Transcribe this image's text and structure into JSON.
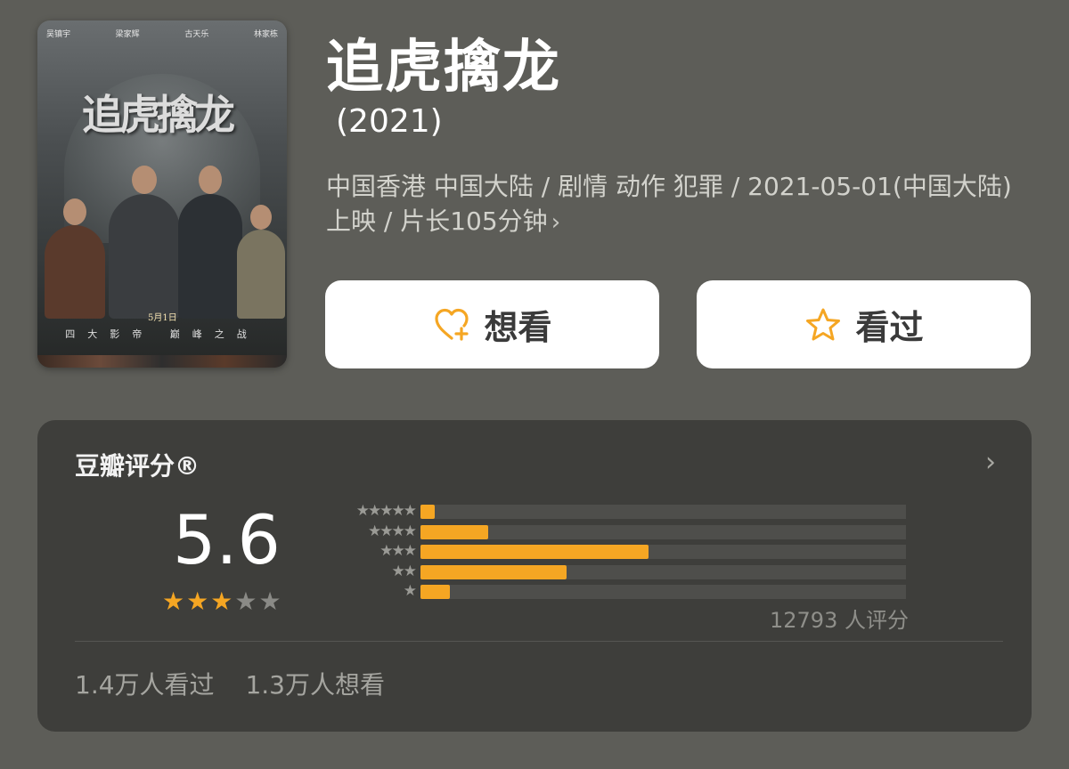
{
  "poster": {
    "title": "追虎擒龙",
    "cast": [
      "吴镇宇",
      "梁家辉",
      "古天乐",
      "林家栋"
    ],
    "tagline": "四大影帝 巅峰之战",
    "date": "5月1日"
  },
  "movie": {
    "title": "追虎擒龙",
    "year": "(2021)",
    "meta": "中国香港 中国大陆 / 剧情 动作 犯罪 / 2021-05-01(中国大陆) 上映 / 片长105分钟"
  },
  "actions": {
    "want_label": "想看",
    "seen_label": "看过",
    "want_icon": "heart-plus-icon",
    "seen_icon": "star-outline-icon",
    "accent": "#f5a623"
  },
  "rating": {
    "title": "豆瓣评分®",
    "score": "5.6",
    "stars_filled": 3,
    "stars_total": 5,
    "votes": "12793 人评分",
    "distribution": [
      {
        "stars": "★★★★★",
        "fraction": 0.03
      },
      {
        "stars": "★★★★",
        "fraction": 0.14
      },
      {
        "stars": "★★★",
        "fraction": 0.47
      },
      {
        "stars": "★★",
        "fraction": 0.3
      },
      {
        "stars": "★",
        "fraction": 0.06
      }
    ]
  },
  "stats": {
    "watched": "1.4万人看过",
    "want": "1.3万人想看"
  }
}
